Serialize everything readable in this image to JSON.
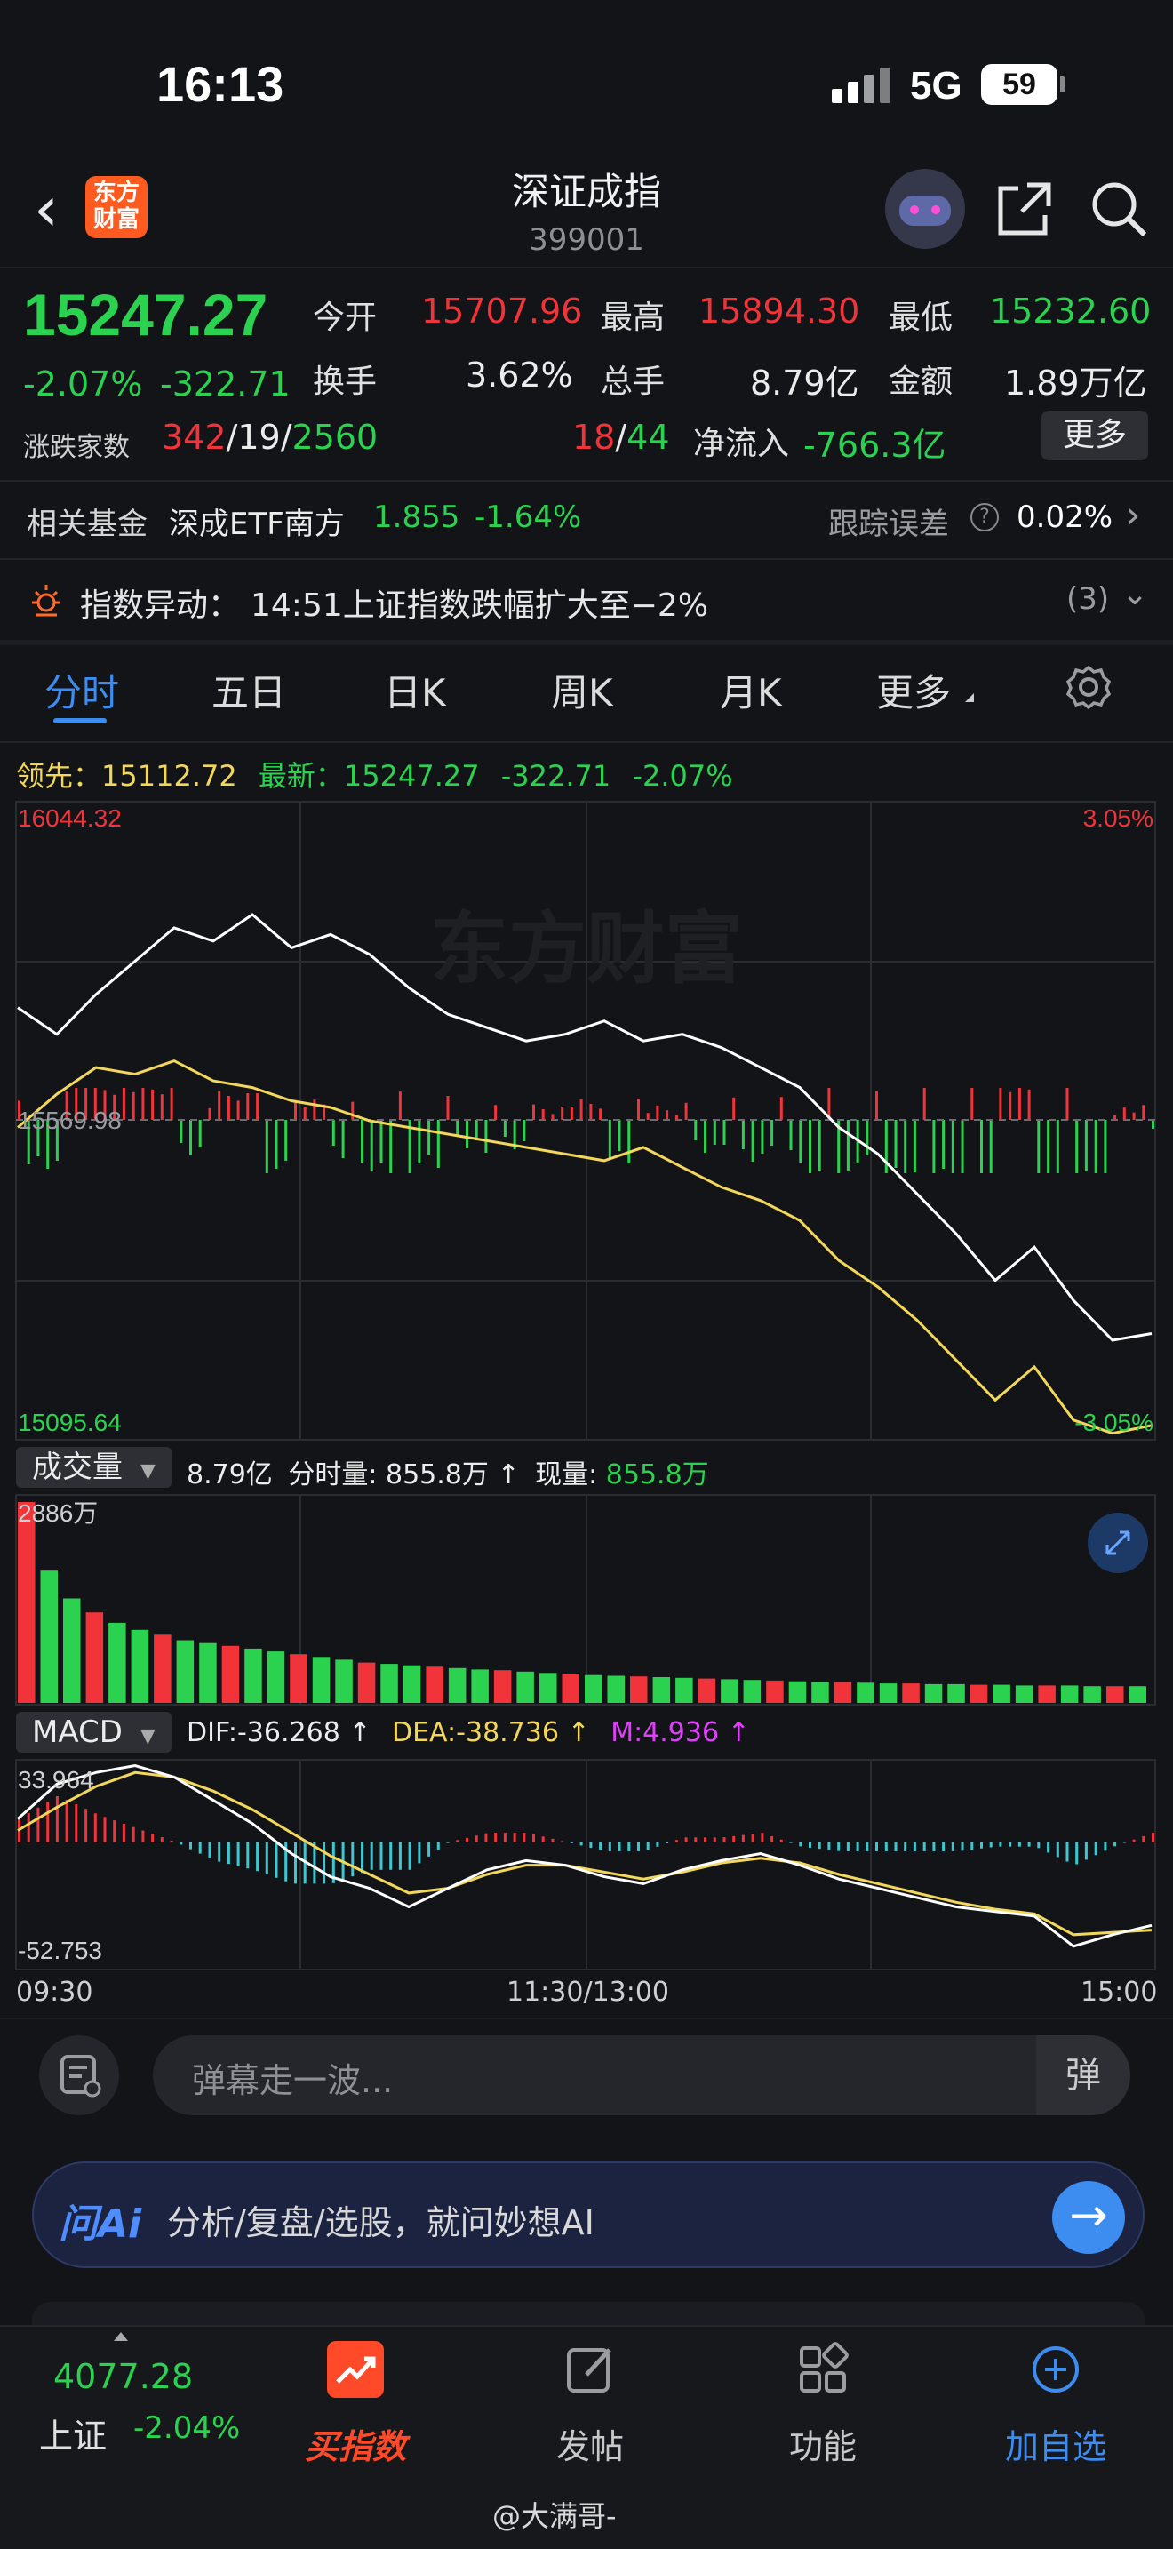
{
  "status_bar": {
    "time": "16:13",
    "network": "5G",
    "battery": "59"
  },
  "header": {
    "title": "深证成指",
    "code": "399001",
    "logo_text_line1": "东方",
    "logo_text_line2": "财富"
  },
  "quote": {
    "price": "15247.27",
    "change_pct": "-2.07%",
    "change": "-322.71",
    "open_label": "今开",
    "open": "15707.96",
    "high_label": "最高",
    "high": "15894.30",
    "low_label": "最低",
    "low": "15232.60",
    "turnover_label": "换手",
    "turnover": "3.62%",
    "volume_label": "总手",
    "volume": "8.79亿",
    "amount_label": "金额",
    "amount": "1.89万亿",
    "breadth_label": "涨跌家数",
    "up": "342",
    "flat": "19",
    "down": "2560",
    "sep": "/",
    "limit_up": "18",
    "limit_down": "44",
    "netflow_label": "净流入",
    "netflow": "-766.3亿",
    "more": "更多"
  },
  "fund": {
    "label": "相关基金",
    "name": "深成ETF南方",
    "price": "1.855",
    "pct": "-1.64%",
    "track_label": "跟踪误差",
    "track_value": "0.02%"
  },
  "alert": {
    "label": "指数异动：",
    "text": "14:51上证指数跌幅扩大至−2%",
    "count": "(3)"
  },
  "tabs": [
    "分时",
    "五日",
    "日K",
    "周K",
    "月K",
    "更多"
  ],
  "chart_legend": {
    "lead_label": "领先：",
    "lead": "15112.72",
    "latest_label": "最新：",
    "latest": "15247.27",
    "change": "-322.71",
    "pct": "-2.07%"
  },
  "volume_panel": {
    "selector": "成交量",
    "total": "8.79亿",
    "minute_label": "分时量:",
    "minute_value": "855.8万",
    "arrow": "↑",
    "current_label": "现量:",
    "current_value": "855.8万",
    "ymax": "2886万"
  },
  "macd_panel": {
    "selector": "MACD",
    "dif": "DIF:-36.268 ↑",
    "dea": "DEA:-38.736 ↑",
    "m": "M:4.936 ↑",
    "ymax": "33.964",
    "ymin": "-52.753"
  },
  "time_axis": [
    "09:30",
    "11:30/13:00",
    "15:00"
  ],
  "watermark": "东方财富",
  "danmu": {
    "placeholder": "弹幕走一波...",
    "button": "弹"
  },
  "ai": {
    "logo": "问Ai",
    "text": "分析/复盘/选股，就问妙想AI",
    "go": "→"
  },
  "bottom_nav": {
    "index_value": "4077.28",
    "index_name": "上证",
    "index_pct": "-2.04%",
    "items": [
      "买指数",
      "发帖",
      "功能",
      "加自选"
    ]
  },
  "footer_watermark": "@大满哥-",
  "colors": {
    "up": "#f0343a",
    "down": "#2bd24f",
    "avg": "#f2d75b",
    "accent": "#3d8cf0"
  },
  "chart_data": [
    {
      "type": "line",
      "title": "",
      "ylim": [
        15095.64,
        16044.32
      ],
      "ytick_labels": [
        "16044.32",
        "15569.98",
        "15095.64"
      ],
      "right_tick_labels": [
        "3.05%",
        "-3.05%"
      ],
      "x_range": [
        "09:30",
        "15:00"
      ],
      "series": [
        {
          "values": [
            15740,
            15700,
            15760,
            15810,
            15860,
            15840,
            15880,
            15830,
            15850,
            15820,
            15770,
            15730,
            15710,
            15690,
            15700,
            15720,
            15690,
            15700,
            15680,
            15650,
            15620,
            15560,
            15520,
            15460,
            15400,
            15330,
            15380,
            15300,
            15240,
            15250
          ]
        },
        {
          "values": [
            15560,
            15610,
            15650,
            15640,
            15660,
            15630,
            15620,
            15600,
            15590,
            15570,
            15560,
            15550,
            15540,
            15530,
            15520,
            15510,
            15530,
            15500,
            15470,
            15450,
            15420,
            15360,
            15320,
            15270,
            15210,
            15150,
            15200,
            15120,
            15100,
            15112
          ]
        }
      ],
      "baseline": 15569.98
    },
    {
      "type": "bar",
      "title": "",
      "ylim": [
        0,
        2886
      ],
      "ylabel": "万",
      "values": [
        2886,
        1900,
        1500,
        1300,
        1150,
        1050,
        980,
        900,
        860,
        820,
        780,
        740,
        700,
        660,
        620,
        580,
        560,
        540,
        520,
        500,
        480,
        470,
        450,
        430,
        420,
        400,
        390,
        380,
        370,
        360,
        350,
        340,
        330,
        320,
        310,
        300,
        300,
        290,
        280,
        280,
        270,
        270,
        260,
        260,
        250,
        250,
        250,
        240,
        240,
        240
      ]
    },
    {
      "type": "line",
      "title": "",
      "ylim": [
        -52.753,
        33.964
      ],
      "series": [
        {
          "name": "DIF",
          "values": [
            10,
            25,
            30,
            33,
            28,
            18,
            8,
            -5,
            -15,
            -20,
            -28,
            -20,
            -12,
            -8,
            -10,
            -15,
            -18,
            -12,
            -8,
            -5,
            -10,
            -16,
            -20,
            -24,
            -28,
            -30,
            -32,
            -45,
            -40,
            -36
          ]
        },
        {
          "name": "DEA",
          "values": [
            5,
            15,
            24,
            30,
            28,
            22,
            14,
            4,
            -6,
            -14,
            -22,
            -20,
            -14,
            -10,
            -10,
            -13,
            -16,
            -13,
            -9,
            -7,
            -9,
            -14,
            -18,
            -22,
            -26,
            -29,
            -31,
            -40,
            -39,
            -38
          ]
        }
      ]
    }
  ]
}
